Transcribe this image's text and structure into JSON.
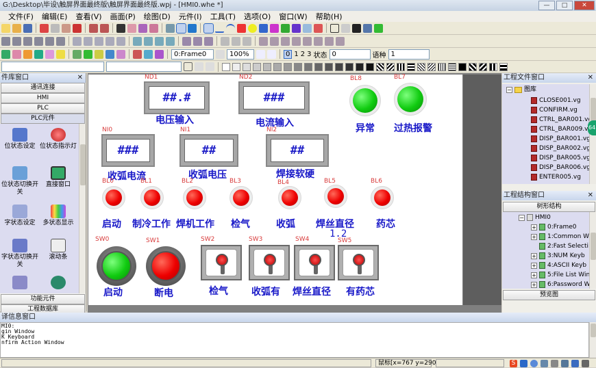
{
  "window": {
    "title": "G:\\Desktop\\毕设\\触屏界面最终版\\触屏界面最终版.wpj - [HMI0.whe *]"
  },
  "menu": [
    "文件(F)",
    "编辑(E)",
    "查看(V)",
    "画面(P)",
    "绘图(D)",
    "元件(I)",
    "工具(T)",
    "选项(O)",
    "窗口(W)",
    "帮助(H)"
  ],
  "toolbar": {
    "frame_combo": "0:Frame0",
    "zoom_combo": "100%",
    "layer_buttons": [
      "0",
      "1",
      "2",
      "3"
    ],
    "state_label": "状态",
    "state_combo": "0",
    "lang_label": "语种",
    "lang_combo": "1"
  },
  "left_panel": {
    "title": "件库窗口",
    "categories": [
      "通讯连接",
      "HMI",
      "PLC",
      "PLC元件"
    ],
    "items": [
      "位状态设定",
      "位状态指示灯",
      "位状态切换开关",
      "直接窗口",
      "字状态设定",
      "多状态显示",
      "字状态切换开关",
      "滚动条",
      "",
      ""
    ],
    "bottom_categories": [
      "功能元件",
      "工程数据库"
    ]
  },
  "hmi": {
    "numeric_displays": [
      {
        "id": "ND1",
        "value": "##.#",
        "label": "电压输入"
      },
      {
        "id": "ND2",
        "value": "###",
        "label": "电流输入"
      }
    ],
    "numeric_inputs": [
      {
        "id": "NI0",
        "value": "###",
        "label": "收弧电流"
      },
      {
        "id": "NI1",
        "value": "##",
        "label": "收弧电压"
      },
      {
        "id": "NI2",
        "value": "##",
        "label": "焊接软硬"
      }
    ],
    "green_lamps": [
      {
        "id": "BL8",
        "label": "异常"
      },
      {
        "id": "BL7",
        "label": "过热报警"
      }
    ],
    "red_lamps": [
      {
        "id": "BL0",
        "label": "启动"
      },
      {
        "id": "BL1",
        "label": "制冷工作"
      },
      {
        "id": "BL2",
        "label": "焊机工作"
      },
      {
        "id": "BL3",
        "label": "检气"
      },
      {
        "id": "BL4",
        "label": "收弧"
      },
      {
        "id": "BL5",
        "label": "焊丝直径"
      },
      {
        "id": "BL6",
        "label": "药芯"
      }
    ],
    "wire_value": "1.2",
    "buttons": [
      {
        "id": "SW0",
        "label": "启动"
      },
      {
        "id": "SW1",
        "label": "断电"
      }
    ],
    "switches": [
      {
        "id": "SW2",
        "label": "检气"
      },
      {
        "id": "SW3",
        "label": "收弧有"
      },
      {
        "id": "SW4",
        "label": "焊丝直径"
      },
      {
        "id": "SW5",
        "label": "有药芯"
      }
    ]
  },
  "right_panel": {
    "file_window_title": "工程文件窗口",
    "library_folder": "图库",
    "files": [
      "CLOSE001.vg",
      "CONFIRM.vg",
      "CTRL_BAR001.vg",
      "CTRL_BAR009.vg",
      "DISP_BAR001.vg",
      "DISP_BAR002.vg",
      "DISP_BAR005.vg",
      "DISP_BAR006.vg",
      "ENTER005.vg"
    ],
    "struct_window_title": "工程结构窗口",
    "tree_title": "树形结构",
    "tree_root": "HMI0",
    "tree_items": [
      "0:Frame0",
      "1:Common W",
      "2:Fast Selecti",
      "3:NUM Keyb",
      "4:ASCII Keyb",
      "5:File List Win",
      "6:Password W"
    ],
    "preview_label": "预览图"
  },
  "side_badge": "64",
  "output": {
    "title": "译信息窗口",
    "lines": [
      "MI0:",
      "gin Window",
      "K Keyboard",
      "nfirm Action Window"
    ]
  },
  "status": {
    "mouse": "鼠标[x=767  y=290]"
  }
}
